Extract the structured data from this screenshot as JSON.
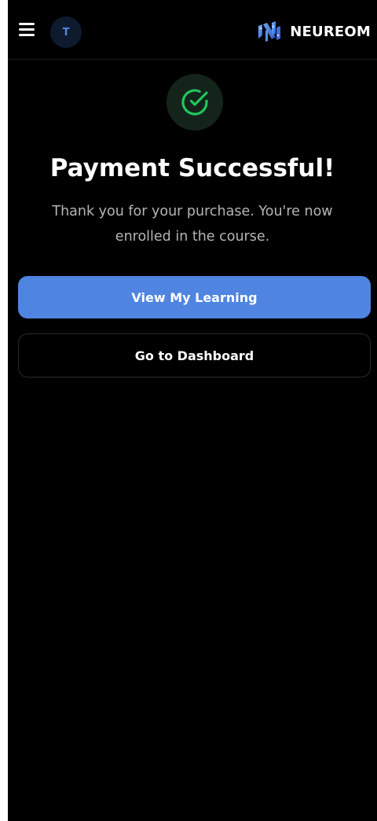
{
  "header": {
    "menu_icon": "hamburger-menu-icon",
    "avatar_initial": "T",
    "brand_logo_icon": "neureom-logo-icon",
    "brand_name": "NEUREOM"
  },
  "main": {
    "status_icon": "check-circle-icon",
    "title": "Payment Successful!",
    "message": "Thank you for your purchase. You're now enrolled in the course.",
    "primary_button_label": "View My Learning",
    "secondary_button_label": "Go to Dashboard"
  },
  "colors": {
    "background": "#000000",
    "accent": "#4f85e0",
    "success": "#22c55e",
    "success_bg": "#14241a",
    "muted_text": "#b5b5b5"
  }
}
